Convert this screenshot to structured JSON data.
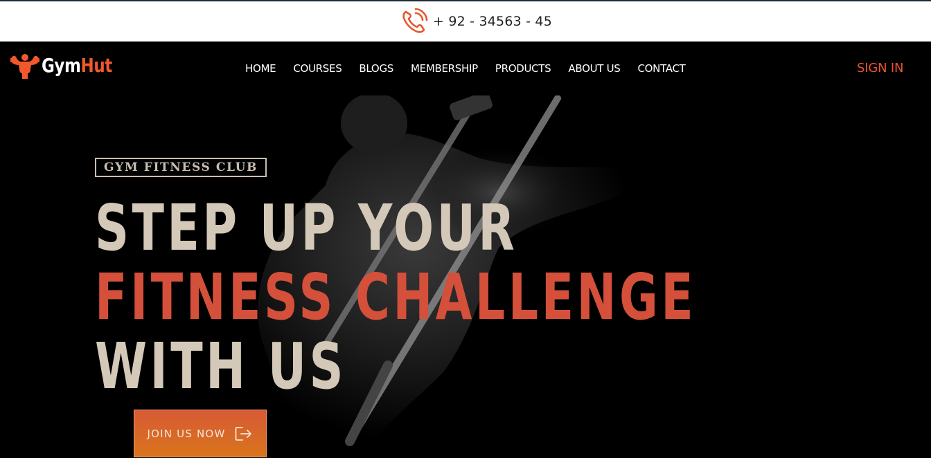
{
  "topbar": {
    "phone": "+ 92 - 34563 - 45",
    "phone_icon": "phone-ringing-icon"
  },
  "brand": {
    "name_part1": "Gym",
    "name_part2": "Hut",
    "logo_icon": "bodybuilder-icon"
  },
  "nav": {
    "items": [
      {
        "label": "HOME"
      },
      {
        "label": "COURSES"
      },
      {
        "label": "BLOGS"
      },
      {
        "label": "MEMBERSHIP"
      },
      {
        "label": "PRODUCTS"
      },
      {
        "label": "ABOUT US"
      },
      {
        "label": "CONTACT"
      }
    ],
    "signin": "SIGN IN"
  },
  "hero": {
    "badge": "GYM FITNESS CLUB",
    "line1": "STEP UP YOUR",
    "line2": "FITNESS CHALLENGE",
    "line3": "WITH US",
    "cta": "JOIN US NOW",
    "cta_icon": "exit-arrow-icon"
  },
  "colors": {
    "accent": "#e8552f",
    "headline_light": "#d4c8b8",
    "headline_accent": "#d4503a",
    "background": "#000000"
  }
}
